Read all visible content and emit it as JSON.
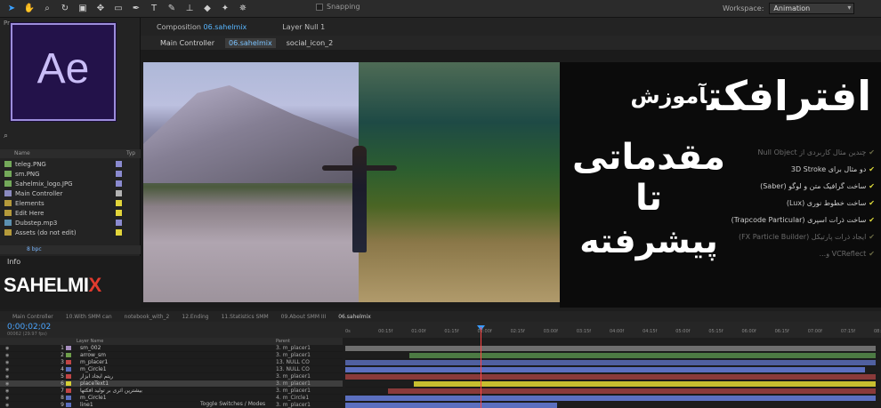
{
  "toolbar": {
    "snapping_label": "Snapping",
    "workspace_label": "Workspace:",
    "workspace_value": "Animation",
    "tools": [
      "arrow-tool",
      "hand-tool",
      "zoom-tool",
      "rotate-tool",
      "camera-tool",
      "pan-behind-tool",
      "rectangle-tool",
      "pen-tool",
      "type-tool",
      "brush-tool",
      "clone-tool",
      "eraser-tool",
      "roto-tool",
      "puppet-tool"
    ]
  },
  "project": {
    "panel_label": "Pr",
    "logo_text": "Ae",
    "search_icon": "⌕",
    "col_name": "Name",
    "col_type": "Typ",
    "items": [
      {
        "label": "teleg.PNG",
        "kind": "img",
        "color": "#8a8acf"
      },
      {
        "label": "sm.PNG",
        "kind": "img",
        "color": "#8a8acf"
      },
      {
        "label": "Sahelmix_logo.JPG",
        "kind": "img",
        "color": "#8a8acf"
      },
      {
        "label": "Main Controller",
        "kind": "comp",
        "color": "#b3b3b3"
      },
      {
        "label": "Elements",
        "kind": "fold",
        "color": "#e2d53b"
      },
      {
        "label": "Edit Here",
        "kind": "fold",
        "color": "#e2d53b"
      },
      {
        "label": "Dubstep.mp3",
        "kind": "aud",
        "color": "#8a8acf"
      },
      {
        "label": "Assets (do not edit)",
        "kind": "fold",
        "color": "#e2d53b"
      }
    ],
    "bpc": "8 bpc"
  },
  "info": {
    "label": "Info",
    "brand_a": "SAHELMI",
    "brand_b": "X"
  },
  "composition": {
    "tab_label": "Composition",
    "tab_name": "06.sahelmix",
    "layer_tab": "Layer Null 1",
    "sub_tabs": [
      "Main Controller",
      "06.sahelmix",
      "social_icon_2"
    ],
    "active_sub": 1
  },
  "overlay": {
    "title_main": "افترافکت",
    "title_small": "آموزش",
    "line2": "مقدماتی",
    "line3": "تا",
    "line4": "پیشرفته",
    "features": [
      {
        "text": "چندین مثال کاربردی از Null Object",
        "dim": true
      },
      {
        "text": "دو مثال برای 3D Stroke",
        "dim": false
      },
      {
        "text": "ساخت گرافیک متن و لوگو (Saber)",
        "dim": false
      },
      {
        "text": "ساخت خطوط نوری (Lux)",
        "dim": false
      },
      {
        "text": "ساخت ذرات اسپری (Trapcode Particular)",
        "dim": false
      },
      {
        "text": "ایجاد ذرات پارتیکل (FX Particle Builder)",
        "dim": true
      },
      {
        "text": "VCReflect و...",
        "dim": true
      }
    ]
  },
  "timeline": {
    "tabs": [
      "Main Controller",
      "10.With SMM can",
      "notebook_with_2",
      "12.Ending",
      "11.Statistics SMM",
      "09.About SMM III",
      "06.sahelmix"
    ],
    "active_tab": 6,
    "timecode": "0;00;02;02",
    "fps": "00062 (29.97 fps)",
    "col_header": "Layer Name",
    "parent_header": "Parent",
    "ruler": [
      "0s",
      "00:15f",
      "01:00f",
      "01:15f",
      "02:00f",
      "02:15f",
      "03:00f",
      "03:15f",
      "04:00f",
      "04:15f",
      "05:00f",
      "05:15f",
      "06:00f",
      "06:15f",
      "07:00f",
      "07:15f",
      "08:0"
    ],
    "layers": [
      {
        "num": "1",
        "name": "sm_002",
        "color": "#a78fbf",
        "parent": "3. m_placer1",
        "bar": {
          "start": 0.0,
          "end": 1.0,
          "color": "#6e6e6e"
        }
      },
      {
        "num": "2",
        "name": "arrow_sm",
        "color": "#6f9f4b",
        "parent": "3. m_placer1",
        "bar": {
          "start": 0.12,
          "end": 1.0,
          "color": "#4c7a43"
        }
      },
      {
        "num": "3",
        "name": "m_placer1",
        "color": "#c04545",
        "parent": "13. NULL CO",
        "bar": {
          "start": 0.0,
          "end": 1.0,
          "color": "#5060a0"
        }
      },
      {
        "num": "4",
        "name": "m_Circle1",
        "color": "#5b6fbf",
        "parent": "13. NULL CO",
        "bar": {
          "start": 0.0,
          "end": 0.98,
          "color": "#5b6fbf"
        }
      },
      {
        "num": "5",
        "name": "ریتم ایجاد ابزار",
        "color": "#c04545",
        "parent": "3. m_placer1",
        "bar": {
          "start": 0.0,
          "end": 1.0,
          "color": "#8a3a3a"
        }
      },
      {
        "num": "6",
        "name": "placeText1",
        "color": "#d6d035",
        "parent": "3. m_placer1",
        "bar": {
          "start": 0.13,
          "end": 1.0,
          "color": "#c8bf2f"
        }
      },
      {
        "num": "7",
        "name": "بیشترین اثری بر تولید افکتها",
        "color": "#c04545",
        "parent": "3. m_placer1",
        "bar": {
          "start": 0.08,
          "end": 1.0,
          "color": "#8a3a3a"
        }
      },
      {
        "num": "8",
        "name": "m_Circle1",
        "color": "#5b6fbf",
        "parent": "4. m_Circle1",
        "bar": {
          "start": 0.0,
          "end": 1.0,
          "color": "#5b6fbf"
        }
      },
      {
        "num": "9",
        "name": "line1",
        "color": "#5b6fbf",
        "parent": "3. m_placer1",
        "bar": {
          "start": 0.0,
          "end": 0.4,
          "color": "#5b6fbf"
        }
      }
    ],
    "toggle_label": "Toggle Switches / Modes"
  }
}
